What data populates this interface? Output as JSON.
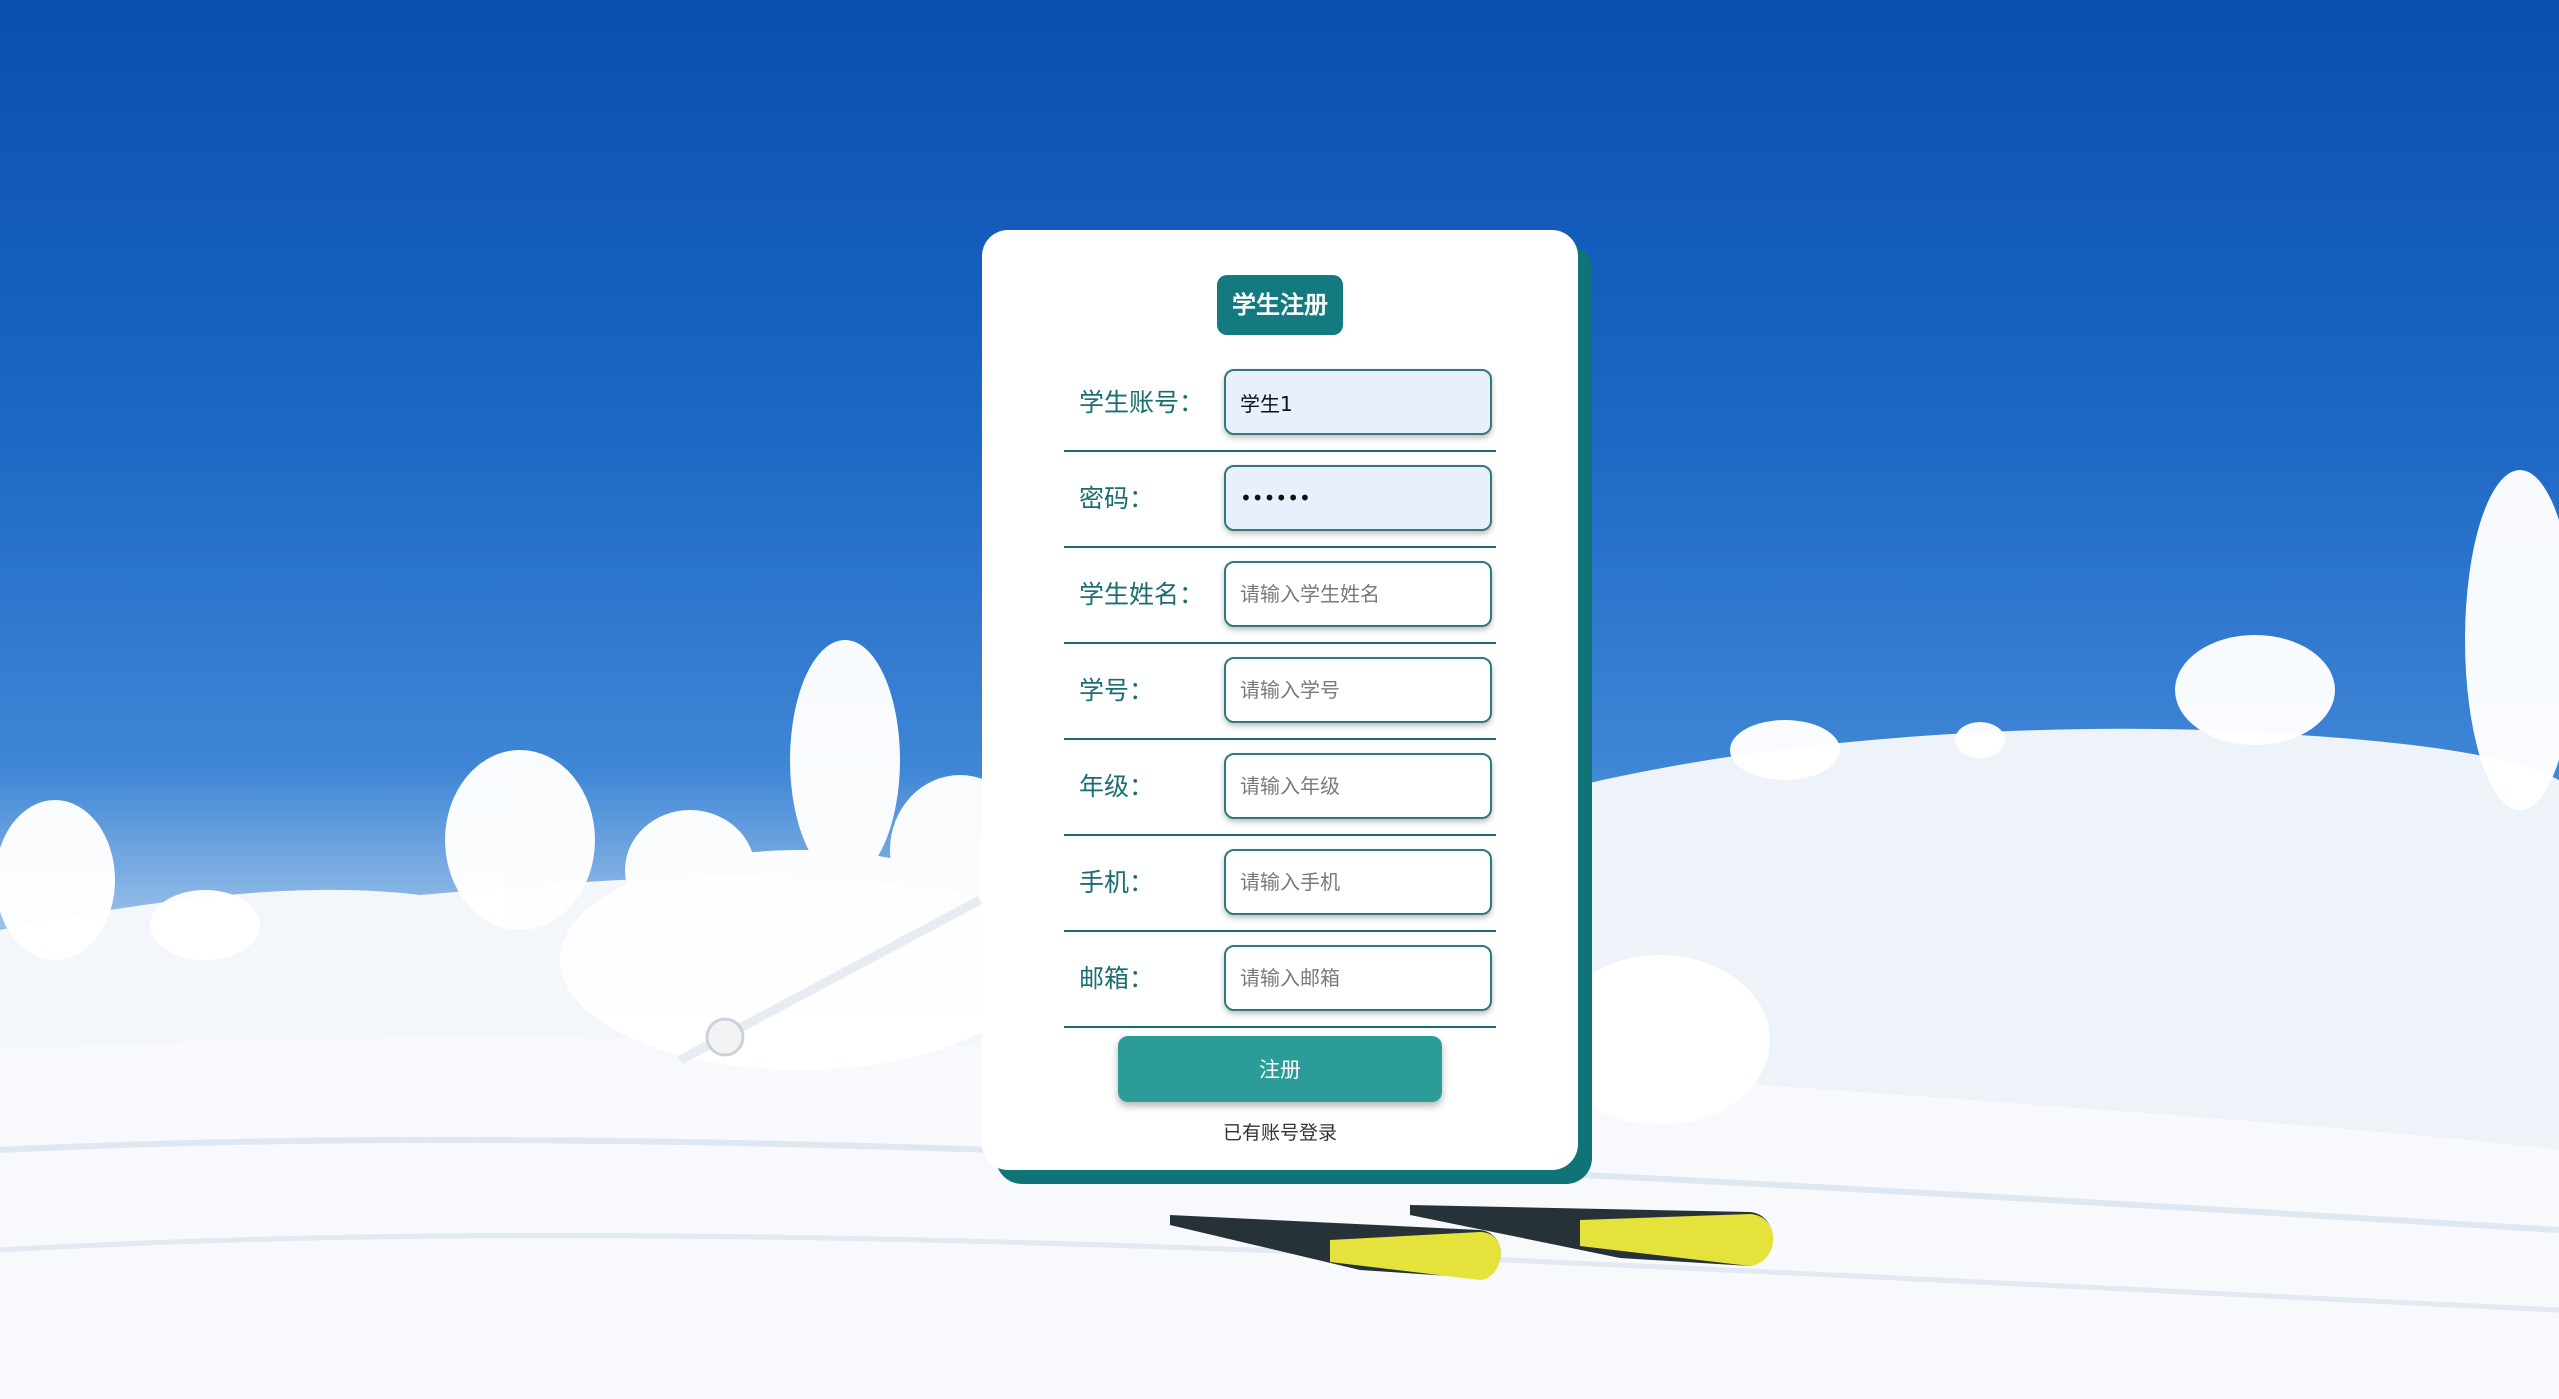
{
  "form": {
    "title": "学生注册",
    "fields": [
      {
        "label": "学生账号：",
        "value": "学生1",
        "placeholder": "",
        "type": "text",
        "filled": true
      },
      {
        "label": "密码：",
        "value": "123456",
        "placeholder": "",
        "type": "password",
        "filled": true
      },
      {
        "label": "学生姓名：",
        "value": "",
        "placeholder": "请输入学生姓名",
        "type": "text",
        "filled": false
      },
      {
        "label": "学号：",
        "value": "",
        "placeholder": "请输入学号",
        "type": "text",
        "filled": false
      },
      {
        "label": "年级：",
        "value": "",
        "placeholder": "请输入年级",
        "type": "text",
        "filled": false
      },
      {
        "label": "手机：",
        "value": "",
        "placeholder": "请输入手机",
        "type": "text",
        "filled": false
      },
      {
        "label": "邮箱：",
        "value": "",
        "placeholder": "请输入邮箱",
        "type": "text",
        "filled": false
      }
    ],
    "submit_label": "注册",
    "login_link": "已有账号登录"
  },
  "colors": {
    "accent": "#137b80",
    "button": "#2b9c98",
    "shadow": "#0f7378",
    "label": "#1a6d72"
  }
}
